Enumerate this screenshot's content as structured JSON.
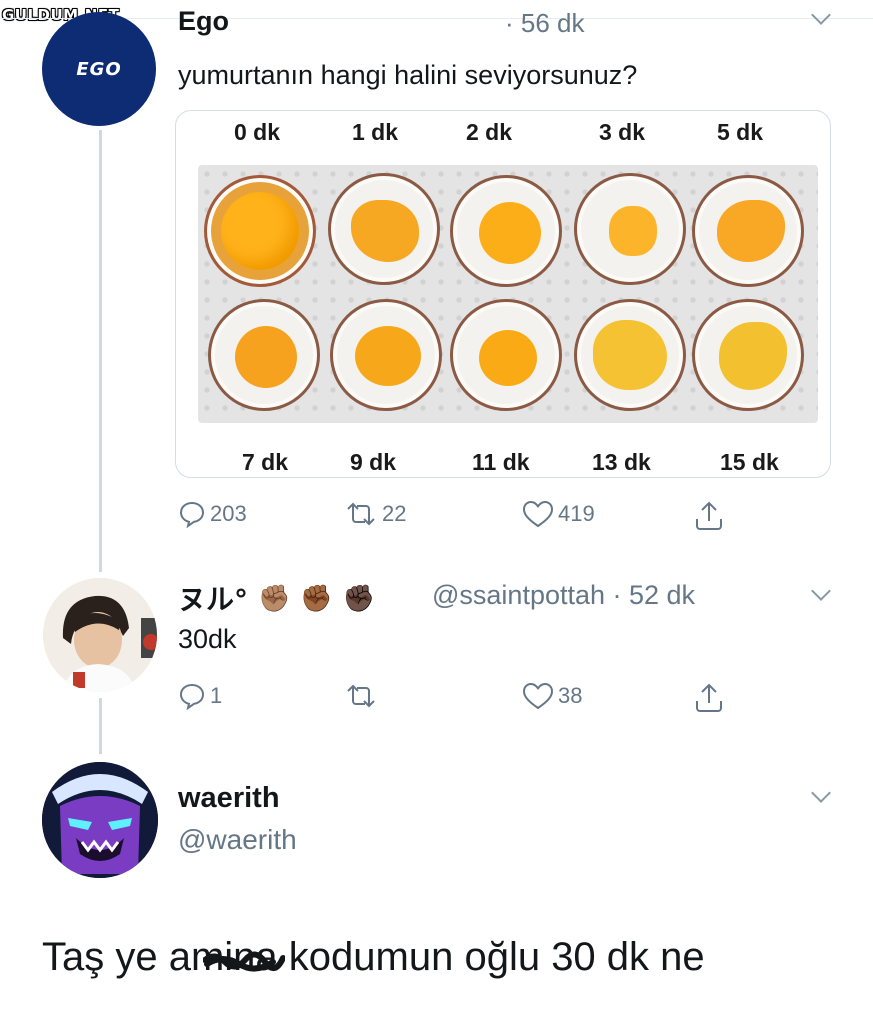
{
  "watermark": "GULDUM.NET",
  "tweet1": {
    "avatar_text": "EGO",
    "name": "Ego",
    "time": "· 56 dk",
    "text": "yumurtanın hangi halini seviyorsunuz?",
    "egg_labels_top": [
      "0 dk",
      "1 dk",
      "2 dk",
      "3 dk",
      "5 dk"
    ],
    "egg_labels_bottom": [
      "7 dk",
      "9 dk",
      "11 dk",
      "13 dk",
      "15 dk"
    ],
    "replies": "203",
    "retweets": "22",
    "likes": "419"
  },
  "tweet2": {
    "name": "ヌル°",
    "fists": [
      "✊🏽",
      "✊🏾",
      "✊🏿"
    ],
    "handle_time": "@ssaintpottah · 52 dk",
    "text": "30dk",
    "replies": "1",
    "likes": "38"
  },
  "reply": {
    "name": "waerith",
    "handle": "@waerith",
    "text_before": "Taş ye a",
    "text_censored": "mina",
    "text_after": " kodumun oğlu 30 dk ne"
  },
  "colors": {
    "link_blue": "#1da1f2",
    "gray": "#657786",
    "ego_blue": "#0e2c74"
  }
}
